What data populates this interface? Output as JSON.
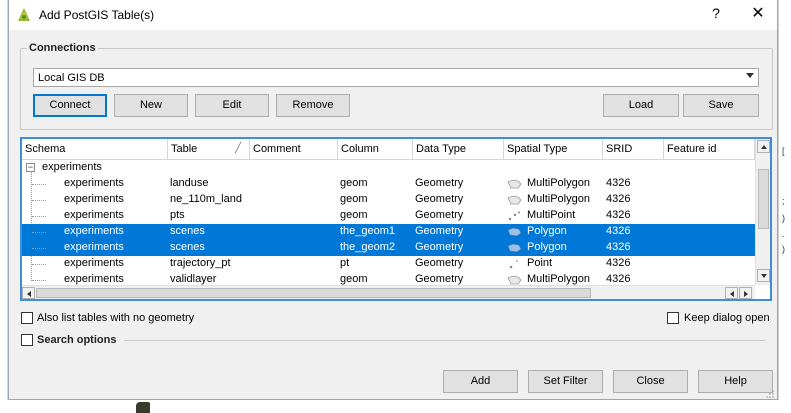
{
  "window": {
    "title": "Add PostGIS Table(s)",
    "help_label": "?",
    "close_label": "✕"
  },
  "connections": {
    "group_title": "Connections",
    "selected": "Local GIS DB",
    "buttons": {
      "connect": "Connect",
      "new": "New",
      "edit": "Edit",
      "remove": "Remove",
      "load": "Load",
      "save": "Save"
    }
  },
  "table": {
    "columns": [
      "Schema",
      "Table",
      "Comment",
      "Column",
      "Data Type",
      "Spatial Type",
      "SRID",
      "Feature id"
    ],
    "group_row": {
      "label": "experiments",
      "expander": "−"
    },
    "rows": [
      {
        "schema": "experiments",
        "table": "landuse",
        "comment": "",
        "column": "geom",
        "data_type": "Geometry",
        "spatial_type": "MultiPolygon",
        "srid": "4326",
        "icon": "multipolygon-icon",
        "selected": false
      },
      {
        "schema": "experiments",
        "table": "ne_110m_land",
        "comment": "",
        "column": "geom",
        "data_type": "Geometry",
        "spatial_type": "MultiPolygon",
        "srid": "4326",
        "icon": "multipolygon-icon",
        "selected": false
      },
      {
        "schema": "experiments",
        "table": "pts",
        "comment": "",
        "column": "geom",
        "data_type": "Geometry",
        "spatial_type": "MultiPoint",
        "srid": "4326",
        "icon": "multipoint-icon",
        "selected": false
      },
      {
        "schema": "experiments",
        "table": "scenes",
        "comment": "",
        "column": "the_geom1",
        "data_type": "Geometry",
        "spatial_type": "Polygon",
        "srid": "4326",
        "icon": "polygon-icon",
        "selected": true
      },
      {
        "schema": "experiments",
        "table": "scenes",
        "comment": "",
        "column": "the_geom2",
        "data_type": "Geometry",
        "spatial_type": "Polygon",
        "srid": "4326",
        "icon": "polygon-icon",
        "selected": true
      },
      {
        "schema": "experiments",
        "table": "trajectory_pt",
        "comment": "",
        "column": "pt",
        "data_type": "Geometry",
        "spatial_type": "Point",
        "srid": "4326",
        "icon": "point-icon",
        "selected": false
      },
      {
        "schema": "experiments",
        "table": "validlayer",
        "comment": "",
        "column": "geom",
        "data_type": "Geometry",
        "spatial_type": "MultiPolygon",
        "srid": "4326",
        "icon": "multipolygon-icon",
        "selected": false
      }
    ]
  },
  "options": {
    "list_no_geometry": {
      "label": "Also list tables with no geometry",
      "checked": false
    },
    "keep_dialog_open": {
      "label": "Keep dialog open",
      "checked": false
    },
    "search_options": {
      "label": "Search options",
      "checked": false
    }
  },
  "footer": {
    "add": "Add",
    "set_filter": "Set Filter",
    "close": "Close",
    "help": "Help"
  },
  "colors": {
    "selection": "#0078d7",
    "frame": "#3c8ee0",
    "default_button_border": "#0078d7"
  }
}
